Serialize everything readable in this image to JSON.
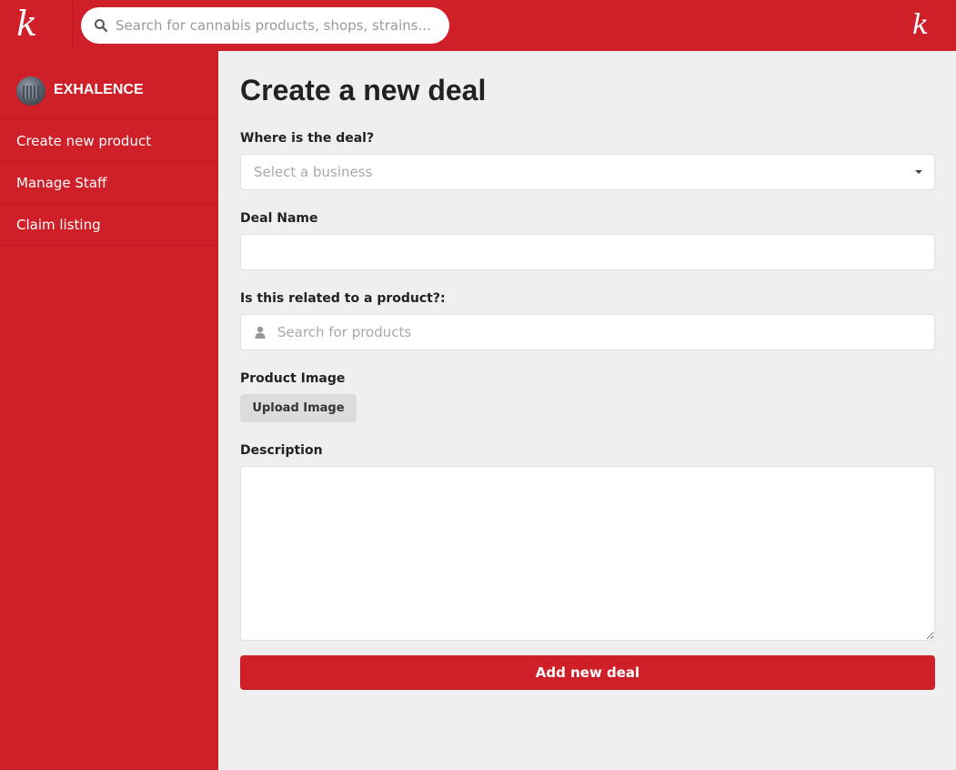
{
  "header": {
    "logo_left": "k",
    "logo_right": "k",
    "search": {
      "placeholder": "Search for cannabis products, shops, strains..."
    }
  },
  "sidebar": {
    "brand_name": "EXHALENCE",
    "items": [
      {
        "label": "Create new product"
      },
      {
        "label": "Manage Staff"
      },
      {
        "label": "Claim listing"
      }
    ]
  },
  "form": {
    "title": "Create a new deal",
    "where_label": "Where is the deal?",
    "business_select": {
      "placeholder": "Select a business"
    },
    "deal_name_label": "Deal Name",
    "deal_name_value": "",
    "product_label": "Is this related to a product?:",
    "product_search": {
      "placeholder": "Search for products"
    },
    "image_label": "Product Image",
    "upload_button": "Upload Image",
    "description_label": "Description",
    "description_value": "",
    "submit_button": "Add new deal"
  },
  "colors": {
    "brand_red": "#cf1f28",
    "page_background": "#efefef",
    "upload_button_bg": "#dcdcdc"
  },
  "icons": {
    "search": "search-icon",
    "dropdown": "chevron-down-icon",
    "product": "user-icon"
  }
}
